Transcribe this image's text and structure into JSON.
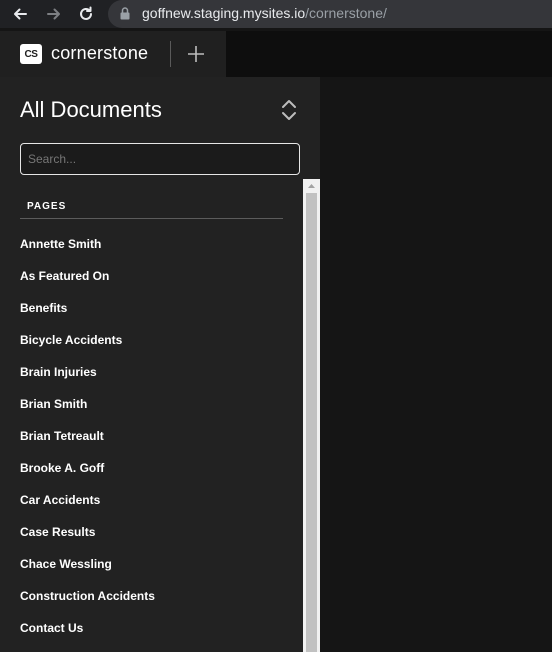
{
  "browser": {
    "url_host": "goffnew.staging.mysites.io",
    "url_path": "/cornerstone/"
  },
  "app": {
    "logo_text": "CS",
    "brand": "cornerstone"
  },
  "sidebar": {
    "title": "All Documents",
    "search_placeholder": "Search...",
    "section_label": "PAGES",
    "pages": [
      "Annette Smith",
      "As Featured On",
      "Benefits",
      "Bicycle Accidents",
      "Brain Injuries",
      "Brian Smith",
      "Brian Tetreault",
      "Brooke A. Goff",
      "Car Accidents",
      "Case Results",
      "Chace Wessling",
      "Construction Accidents",
      "Contact Us"
    ]
  },
  "colors": {
    "sidebar_bg": "#222222",
    "main_bg": "#151515",
    "text": "#ffffff"
  }
}
